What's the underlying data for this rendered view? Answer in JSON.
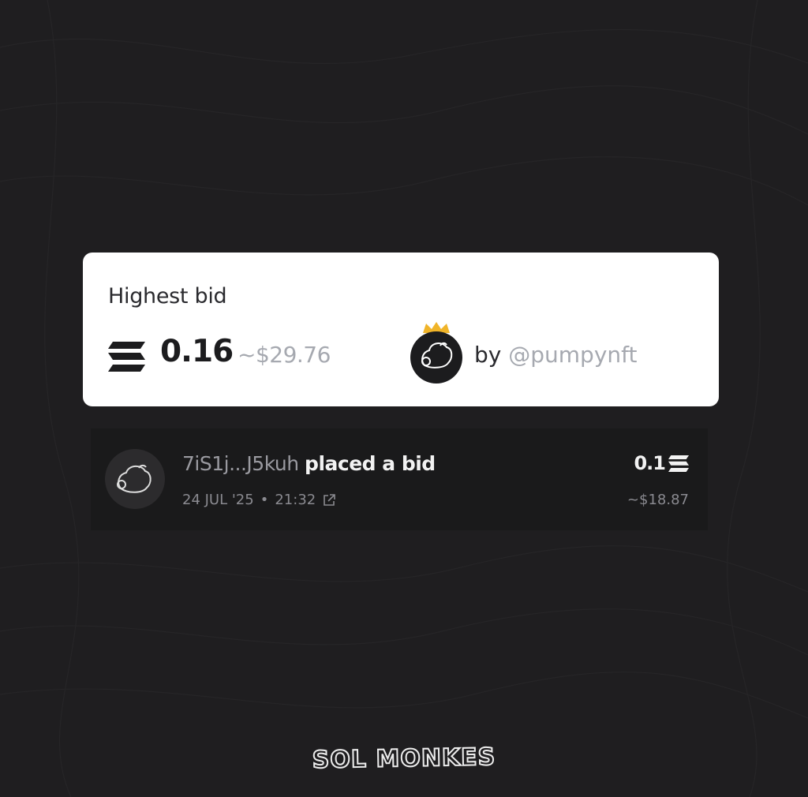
{
  "highest_bid": {
    "heading": "Highest bid",
    "amount": "0.16",
    "usd": "~$29.76",
    "by_label": "by",
    "bidder": "@pumpynft"
  },
  "activity": {
    "address": "7iS1j...J5kuh",
    "action": "placed a bid",
    "date": "24 JUL '25",
    "separator": "•",
    "time": "21:32",
    "amount": "0.1",
    "usd": "~$18.87"
  },
  "brand": {
    "logo_text": "SOL MONKES"
  },
  "icons": {
    "currency": "solana-icon",
    "external_link": "external-link-icon",
    "crown": "crown-icon",
    "avatar": "monke-avatar-icon"
  },
  "colors": {
    "background": "#1f1e20",
    "card": "#ffffff",
    "crown": "#f0b429",
    "muted_text": "#a6a9b0"
  }
}
